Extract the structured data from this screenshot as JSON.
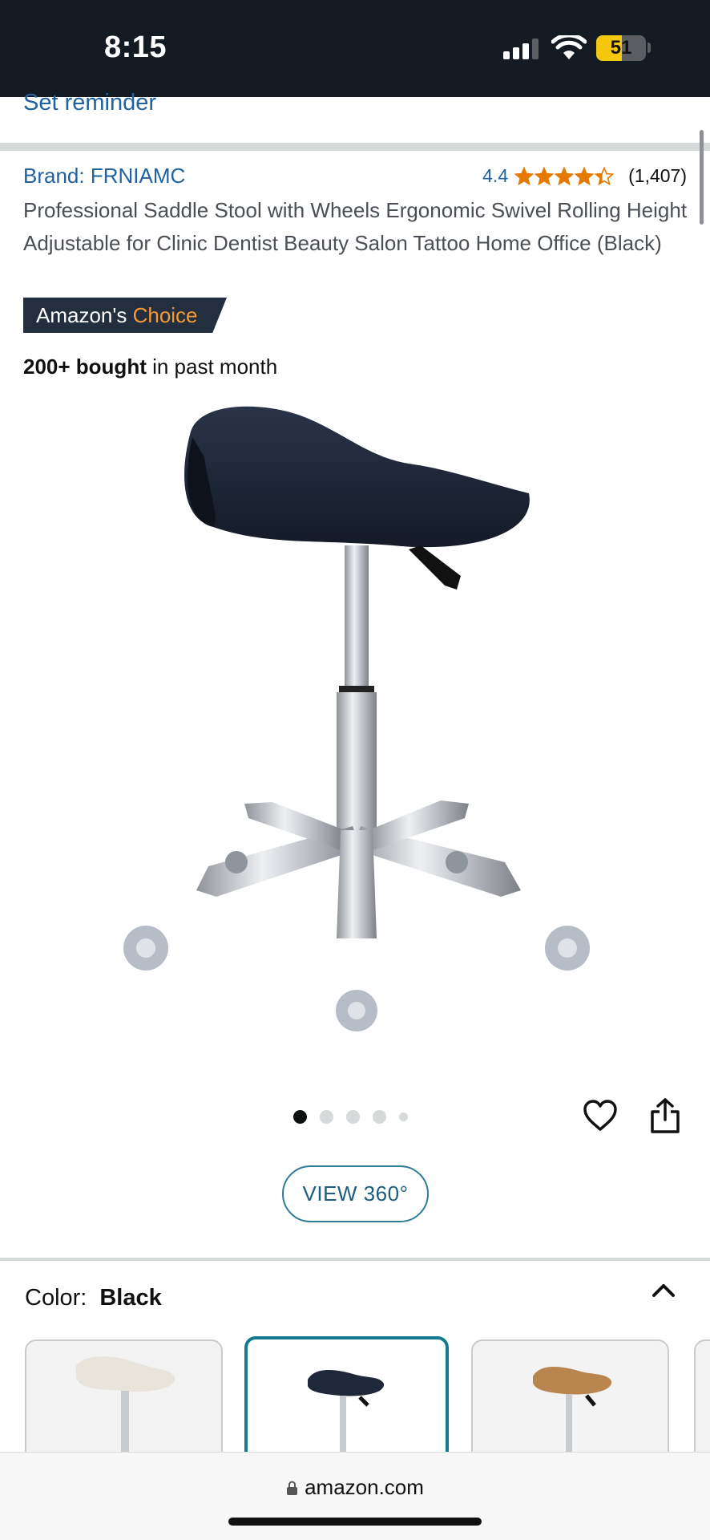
{
  "status_bar": {
    "time": "8:15",
    "battery": "51"
  },
  "reminder": {
    "label": "Set reminder"
  },
  "product": {
    "brand": "Brand: FRNIAMC",
    "rating": "4.4",
    "rating_count": "(1,407)",
    "stars_filled": 4.4,
    "title": "Professional Saddle Stool with Wheels Ergonomic Swivel Rolling Height Adjustable for Clinic Dentist Beauty Salon Tattoo Home Office (Black)",
    "badge_prefix": "Amazon's",
    "badge_accent": "Choice",
    "bought_bold": "200+ bought",
    "bought_rest": " in past month"
  },
  "carousel": {
    "total_images": 5,
    "active_index": 0
  },
  "view360": {
    "label": "VIEW 360°"
  },
  "color": {
    "label": "Color:",
    "value": "Black",
    "options": [
      "White",
      "Black",
      "Brown"
    ],
    "selected": "Black"
  },
  "browser": {
    "url": "amazon.com"
  },
  "colors": {
    "link": "#2162a1",
    "star": "#e67a00",
    "badge_bg": "#232f3e",
    "badge_accent": "#f69931",
    "selected_border": "#137a8e"
  }
}
